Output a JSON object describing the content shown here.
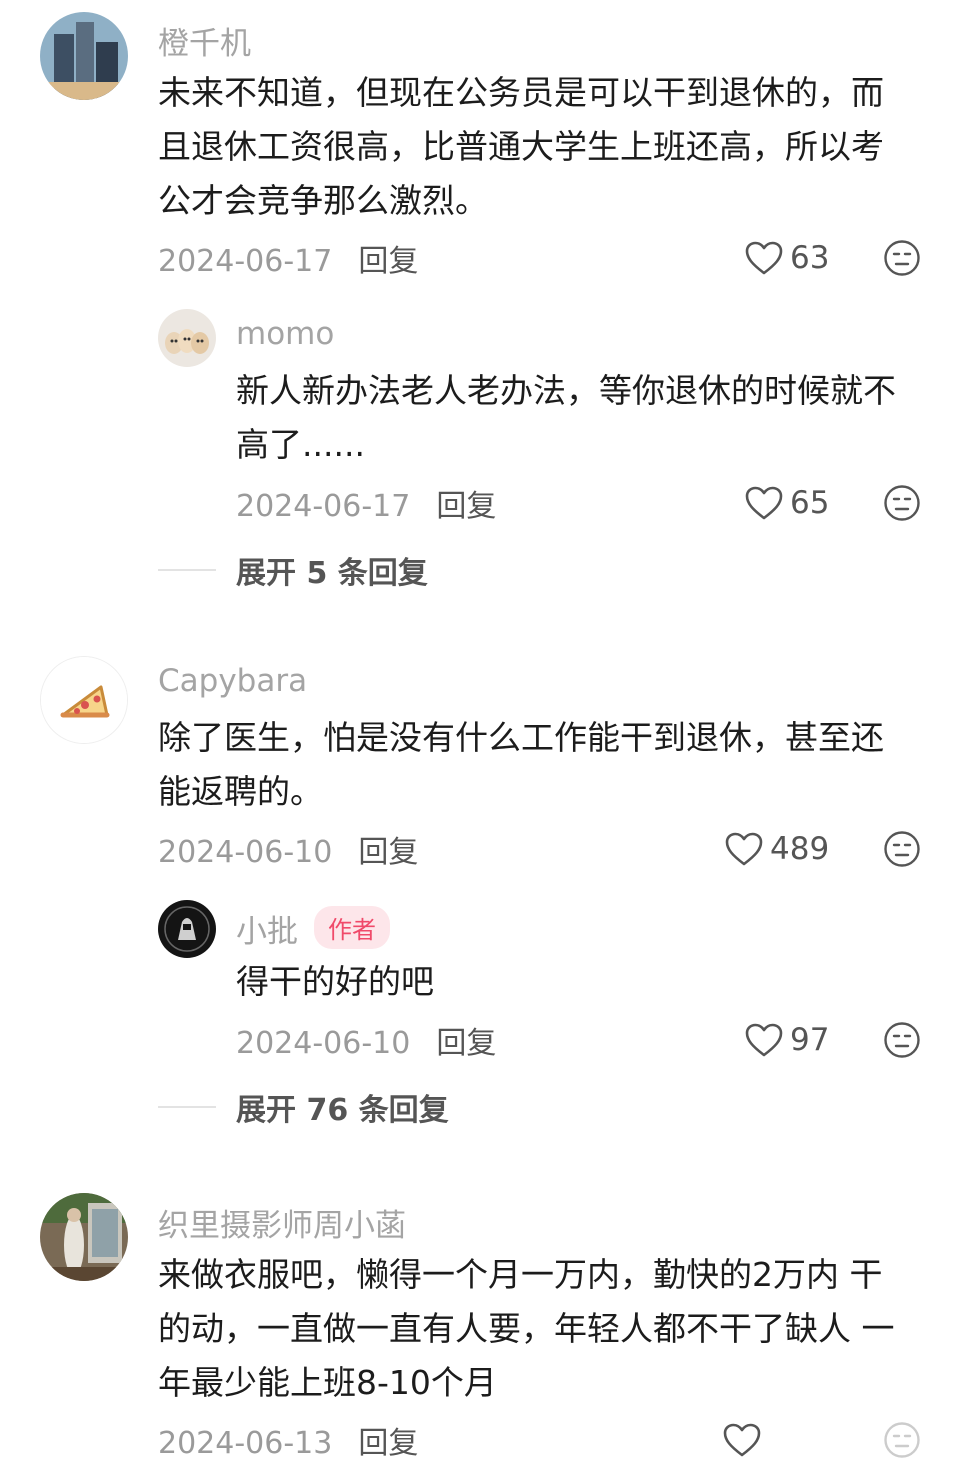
{
  "comments": [
    {
      "username": "橙千机",
      "text_lines": [
        "未来不知道，但现在公务员是可以干到退休的，而",
        "且退休工资很高，比普通大学生上班还高，所以考",
        "公才会竞争那么激烈。"
      ],
      "date": "2024-06-17",
      "reply_label": "回复",
      "likes": "63",
      "replies": [
        {
          "username": "momo",
          "text_lines": [
            "新人新办法老人老办法，等你退休的时候就不",
            "高了......"
          ],
          "date": "2024-06-17",
          "reply_label": "回复",
          "likes": "65"
        }
      ],
      "expand_label": "展开 5 条回复"
    },
    {
      "username": "Capybara",
      "text_lines": [
        "除了医生，怕是没有什么工作能干到退休，甚至还",
        "能返聘的。"
      ],
      "date": "2024-06-10",
      "reply_label": "回复",
      "likes": "489",
      "replies": [
        {
          "username": "小批",
          "author_tag": "作者",
          "text_lines": [
            "得干的好的吧"
          ],
          "date": "2024-06-10",
          "reply_label": "回复",
          "likes": "97"
        }
      ],
      "expand_label": "展开 76 条回复"
    },
    {
      "username": "织里摄影师周小菡",
      "text_lines": [
        "来做衣服吧，懒得一个月一万内，勤快的2万内 干",
        "的动，一直做一直有人要，年轻人都不干了缺人 一",
        "年最少能上班8-10个月"
      ],
      "date": "2024-06-13",
      "reply_label": "回复"
    }
  ],
  "icons": {
    "like": "heart-outline-icon",
    "dislike": "neutral-face-icon"
  },
  "colors": {
    "accent_tag_bg": "#fde6ea",
    "accent_tag_text": "#f04a6a"
  }
}
